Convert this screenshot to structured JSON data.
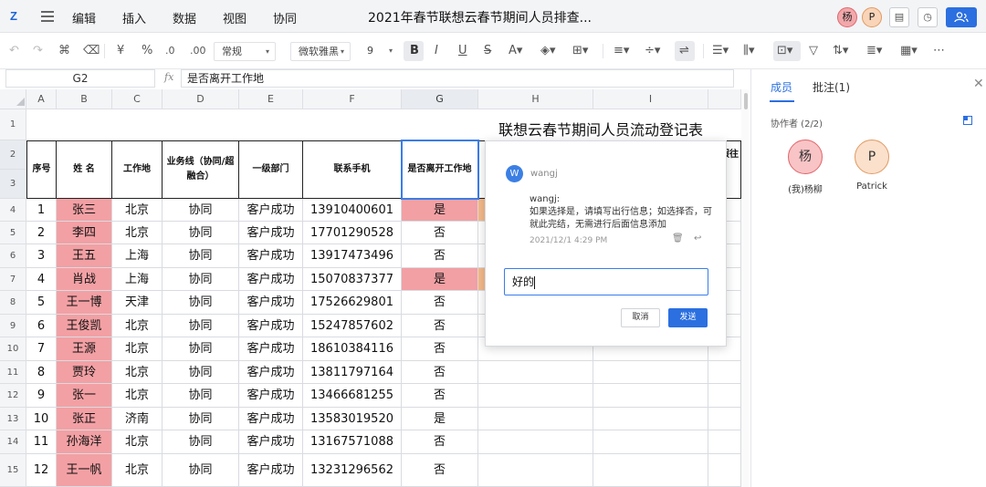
{
  "app": {
    "logo_text": "Z",
    "doc_title": "2021年春节联想云春节期间人员排查...",
    "menu": [
      "编辑",
      "插入",
      "数据",
      "视图",
      "协同"
    ],
    "avatars": [
      {
        "label": "杨",
        "color": "#f2a8ab"
      },
      {
        "label": "P",
        "color": "#f9d4b8"
      }
    ]
  },
  "toolbar": {
    "number_format": "常规",
    "font_name": "微软雅黑",
    "font_size": "9"
  },
  "formula_bar": {
    "cell_ref": "G2",
    "fx_label": "fx",
    "value": "是否离开工作地"
  },
  "sheet": {
    "columns": [
      "A",
      "B",
      "C",
      "D",
      "E",
      "F",
      "G",
      "H",
      "I",
      ""
    ],
    "row_numbers": [
      "1",
      "2",
      "3",
      "4",
      "5",
      "6",
      "7",
      "8",
      "9",
      "10",
      "11",
      "12",
      "13",
      "14",
      "15"
    ],
    "title": "联想云春节期间人员流动登记表",
    "headers": {
      "seq": "序号",
      "name": "姓 名",
      "workplace": "工作地",
      "business": "业务线（协同/超融合）",
      "dept": "一级部门",
      "phone": "联系手机",
      "left": "是否离开工作地",
      "partial": "节假往"
    },
    "rows": [
      {
        "seq": "1",
        "name": "张三",
        "workplace": "北京",
        "business": "协同",
        "dept": "客户成功",
        "phone": "13910400601",
        "left": "是"
      },
      {
        "seq": "2",
        "name": "李四",
        "workplace": "北京",
        "business": "协同",
        "dept": "客户成功",
        "phone": "17701290528",
        "left": "否"
      },
      {
        "seq": "3",
        "name": "王五",
        "workplace": "上海",
        "business": "协同",
        "dept": "客户成功",
        "phone": "13917473496",
        "left": "否"
      },
      {
        "seq": "4",
        "name": "肖战",
        "workplace": "上海",
        "business": "协同",
        "dept": "客户成功",
        "phone": "15070837377",
        "left": "是"
      },
      {
        "seq": "5",
        "name": "王一博",
        "workplace": "天津",
        "business": "协同",
        "dept": "客户成功",
        "phone": "17526629801",
        "left": "否"
      },
      {
        "seq": "6",
        "name": "王俊凯",
        "workplace": "北京",
        "business": "协同",
        "dept": "客户成功",
        "phone": "15247857602",
        "left": "否"
      },
      {
        "seq": "7",
        "name": "王源",
        "workplace": "北京",
        "business": "协同",
        "dept": "客户成功",
        "phone": "18610384116",
        "left": "否"
      },
      {
        "seq": "8",
        "name": "贾玲",
        "workplace": "北京",
        "business": "协同",
        "dept": "客户成功",
        "phone": "13811797164",
        "left": "否"
      },
      {
        "seq": "9",
        "name": "张一",
        "workplace": "北京",
        "business": "协同",
        "dept": "客户成功",
        "phone": "13466681255",
        "left": "否"
      },
      {
        "seq": "10",
        "name": "张正",
        "workplace": "济南",
        "business": "协同",
        "dept": "客户成功",
        "phone": "13583019520",
        "left": "是"
      },
      {
        "seq": "11",
        "name": "孙海洋",
        "workplace": "北京",
        "business": "协同",
        "dept": "客户成功",
        "phone": "13167571088",
        "left": "否"
      },
      {
        "seq": "12",
        "name": "王一帆",
        "workplace": "北京",
        "business": "协同",
        "dept": "客户成功",
        "phone": "13231296562",
        "left": "否"
      }
    ],
    "colors": {
      "name_bg": "#f2a0a4",
      "yes_bg": "#f2a0a4",
      "partial_bg": "#f4b98a",
      "selection": "#3a7de8"
    }
  },
  "comment": {
    "avatar": "W",
    "user": "wangj",
    "body_user": "wangj:",
    "body_text": "如果选择是，请填写出行信息；如选择否，可就此完结，无需进行后面信息添加",
    "time": "2021/12/1 4:29 PM",
    "input_value": "好的",
    "cancel": "取消",
    "send": "发送"
  },
  "panel": {
    "tab_members": "成员",
    "tab_comments": "批注(1)",
    "collaborators": "协作者 (2/2)",
    "members": [
      {
        "avatar": "杨",
        "name": "(我)杨柳",
        "color": "#f2a8ab"
      },
      {
        "avatar": "P",
        "name": "Patrick",
        "color": "#f9d4b8"
      }
    ]
  }
}
